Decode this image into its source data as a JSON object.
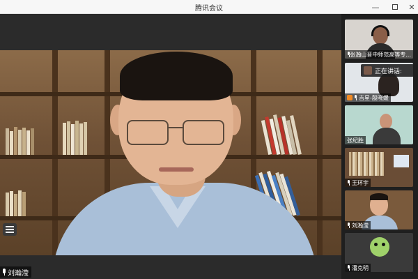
{
  "window": {
    "title": "腾讯会议"
  },
  "main": {
    "speaker_name": "刘瀚滢"
  },
  "speaking_indicator": {
    "label": "正在讲话:"
  },
  "participants": [
    {
      "name": "张瀚山晋中师范高等专..."
    },
    {
      "name": "吉星-殷晓媛"
    },
    {
      "name": "张纪胜"
    },
    {
      "name": "王环宇"
    },
    {
      "name": "刘瀚滢"
    },
    {
      "name": "潘克明"
    }
  ],
  "colors": {
    "accent": "#f08a24",
    "sidebar_bg": "#1f1f1f",
    "main_bg": "#2b2b2b",
    "titlebar_bg": "#f7f7f7"
  },
  "icons": {
    "minimize": "minimize-icon",
    "maximize": "maximize-icon",
    "close": "close-icon",
    "mic": "mic-icon",
    "layout": "list-layout-icon"
  }
}
